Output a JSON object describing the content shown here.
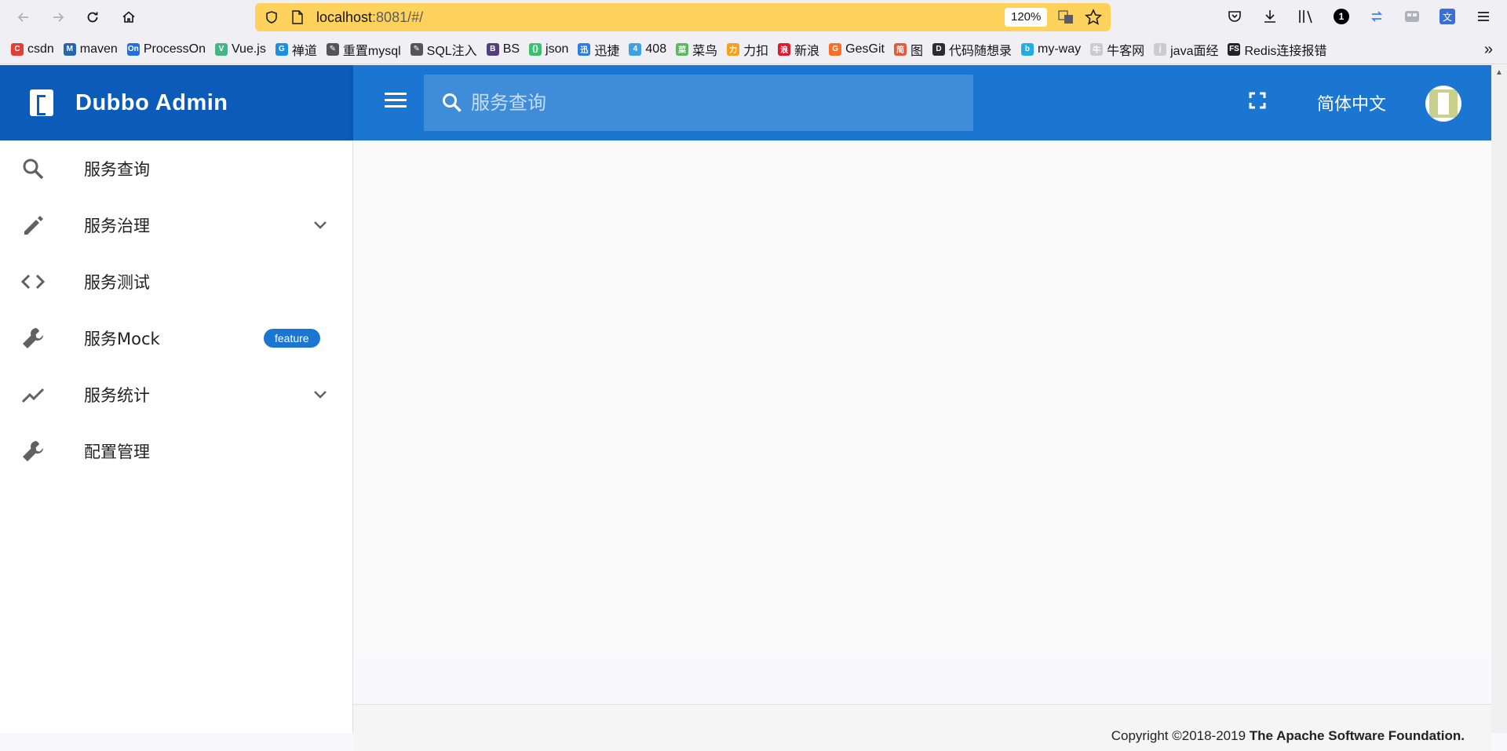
{
  "browser": {
    "url_host": "localhost",
    "url_rest": ":8081/#/",
    "zoom": "120%",
    "bookmarks": [
      {
        "label": "csdn",
        "color": "#e33e33",
        "glyph": "C"
      },
      {
        "label": "maven",
        "color": "#2466b0",
        "glyph": "M"
      },
      {
        "label": "ProcessOn",
        "color": "#1f6fe0",
        "glyph": "On"
      },
      {
        "label": "Vue.js",
        "color": "#41b883",
        "glyph": "V"
      },
      {
        "label": "禅道",
        "color": "#1a8ee2",
        "glyph": "G"
      },
      {
        "label": "重置mysql",
        "color": "#555555",
        "glyph": "✎"
      },
      {
        "label": "SQL注入",
        "color": "#555555",
        "glyph": "✎"
      },
      {
        "label": "BS",
        "color": "#563d7c",
        "glyph": "B"
      },
      {
        "label": "json",
        "color": "#36c36c",
        "glyph": "{}"
      },
      {
        "label": "迅捷",
        "color": "#2b7de1",
        "glyph": "迅"
      },
      {
        "label": "408",
        "color": "#3aa0e8",
        "glyph": "4"
      },
      {
        "label": "菜鸟",
        "color": "#5cb85c",
        "glyph": "菜"
      },
      {
        "label": "力扣",
        "color": "#f89f1b",
        "glyph": "力"
      },
      {
        "label": "新浪",
        "color": "#e6162d",
        "glyph": "浪"
      },
      {
        "label": "GesGit",
        "color": "#fc6d26",
        "glyph": "G"
      },
      {
        "label": "图",
        "color": "#e55a3b",
        "glyph": "简"
      },
      {
        "label": "代码随想录",
        "color": "#2d2d2d",
        "glyph": "D"
      },
      {
        "label": "my-way",
        "color": "#23ade5",
        "glyph": "b"
      },
      {
        "label": "牛客网",
        "color": "#cccccc",
        "glyph": "牛"
      },
      {
        "label": "java面经",
        "color": "#cccccc",
        "glyph": "j"
      },
      {
        "label": "Redis连接报错",
        "color": "#222222",
        "glyph": "FS"
      }
    ]
  },
  "app": {
    "brand_title": "Dubbo Admin",
    "search_placeholder": "服务查询",
    "language": "简体中文"
  },
  "sidebar": {
    "items": [
      {
        "label": "服务查询",
        "icon": "search-icon"
      },
      {
        "label": "服务治理",
        "icon": "pencil-icon",
        "expandable": true
      },
      {
        "label": "服务测试",
        "icon": "code-icon"
      },
      {
        "label": "服务Mock",
        "icon": "wrench-icon",
        "badge": "feature"
      },
      {
        "label": "服务统计",
        "icon": "trending-icon",
        "expandable": true
      },
      {
        "label": "配置管理",
        "icon": "wrench-icon"
      }
    ]
  },
  "footer": {
    "copyright": "Copyright ©2018-2019",
    "owner": "The Apache Software Foundation."
  },
  "colors": {
    "brand": "#0d5bb8",
    "topbar": "#1b76d2",
    "badge": "#1b76d2"
  }
}
